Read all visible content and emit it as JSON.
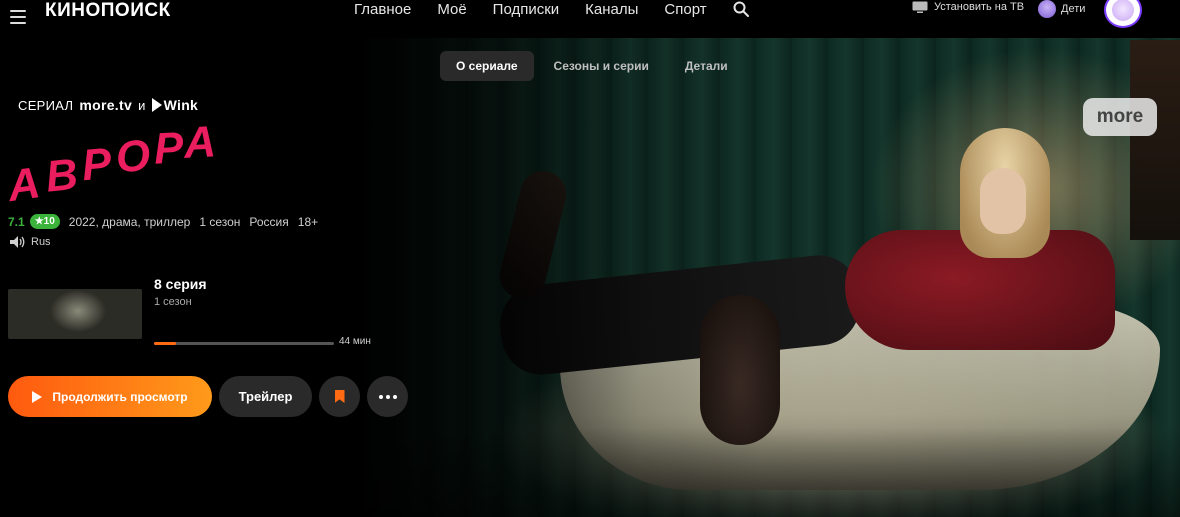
{
  "header": {
    "logo": "КИНОПОИСК",
    "nav": [
      "Главное",
      "Моё",
      "Подписки",
      "Каналы",
      "Спорт"
    ],
    "tv_label": "Установить на ТВ",
    "kids_label": "Дети"
  },
  "tabs": [
    {
      "label": "О сериале",
      "active": true
    },
    {
      "label": "Сезоны и серии",
      "active": false
    },
    {
      "label": "Детали",
      "active": false
    }
  ],
  "show": {
    "brand_prefix": "СЕРИАЛ",
    "brand_moretv": "more.tv",
    "brand_and": "и",
    "brand_wink": "Wink",
    "title": "АВРОРА",
    "rating": "7.1",
    "rating_badge": "★10",
    "meta": [
      "2022, драма, триллер",
      "1 сезон",
      "Россия",
      "18+"
    ],
    "audio": "Rus"
  },
  "episode": {
    "title": "8 серия",
    "season": "1 сезон",
    "progress": 0.12,
    "duration": "44 мин"
  },
  "buttons": {
    "play": "Продолжить просмотр",
    "trailer": "Трейлер"
  },
  "watermark": "more",
  "colors": {
    "accent": "#ff6a13",
    "title": "#ea1d5e",
    "rating": "#3bb33b",
    "avatar_ring": "#7c3cff"
  }
}
